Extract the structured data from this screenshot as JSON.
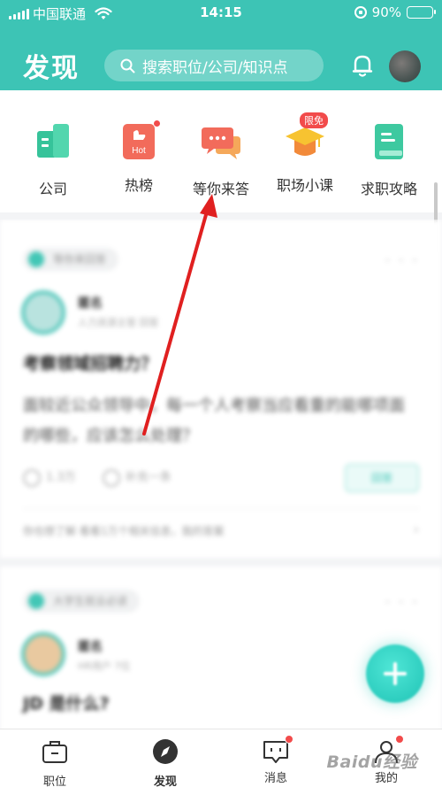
{
  "status_bar": {
    "carrier": "中国联通",
    "time": "14:15",
    "battery": "90%",
    "battery_level": 0.9
  },
  "header": {
    "title": "发现",
    "search_placeholder": "搜索职位/公司/知识点"
  },
  "categories": [
    {
      "label": "公司",
      "icon": "building-icon",
      "color": "#3ec9a0"
    },
    {
      "label": "热榜",
      "icon": "hot-icon",
      "badge_text": "Hot",
      "has_dot": true,
      "color": "#f26b5b"
    },
    {
      "label": "等你来答",
      "icon": "chat-bubble-icon",
      "color": "#f26b5b"
    },
    {
      "label": "职场小课",
      "icon": "graduation-cap-icon",
      "badge": "限免",
      "color": "#f5b630"
    },
    {
      "label": "求职攻略",
      "icon": "notebook-icon",
      "color": "#3ec9a0"
    }
  ],
  "feed": {
    "card1": {
      "tag": "等你来回答",
      "user_name": "匿名",
      "user_sub": "人力资源主管 回答",
      "question": "考察领域招聘力？",
      "body": "面较近公众领导中，每一个人考察当应看重的能哪项面的哪些，应该怎么处理？",
      "likes": "1.3万",
      "comments": "补充一条",
      "answer_btn": "回答",
      "hint": "你也想了解 看看1万个相关信息，我的答案"
    },
    "card2": {
      "tag": "大学生就业必读",
      "user_name": "匿名",
      "user_sub": "HR用户 7位",
      "question": "JD 是什么?"
    }
  },
  "tabbar": [
    {
      "label": "职位",
      "icon": "briefcase-icon",
      "active": false
    },
    {
      "label": "发现",
      "icon": "compass-icon",
      "active": true
    },
    {
      "label": "消息",
      "icon": "message-icon",
      "active": false,
      "has_dot": true
    },
    {
      "label": "我的",
      "icon": "profile-icon",
      "active": false,
      "has_dot": true
    }
  ],
  "watermark": "Baidu经验",
  "colors": {
    "brand": "#3dc4b5",
    "alert_red": "#f24b4b",
    "annotation_arrow": "#e02020"
  }
}
